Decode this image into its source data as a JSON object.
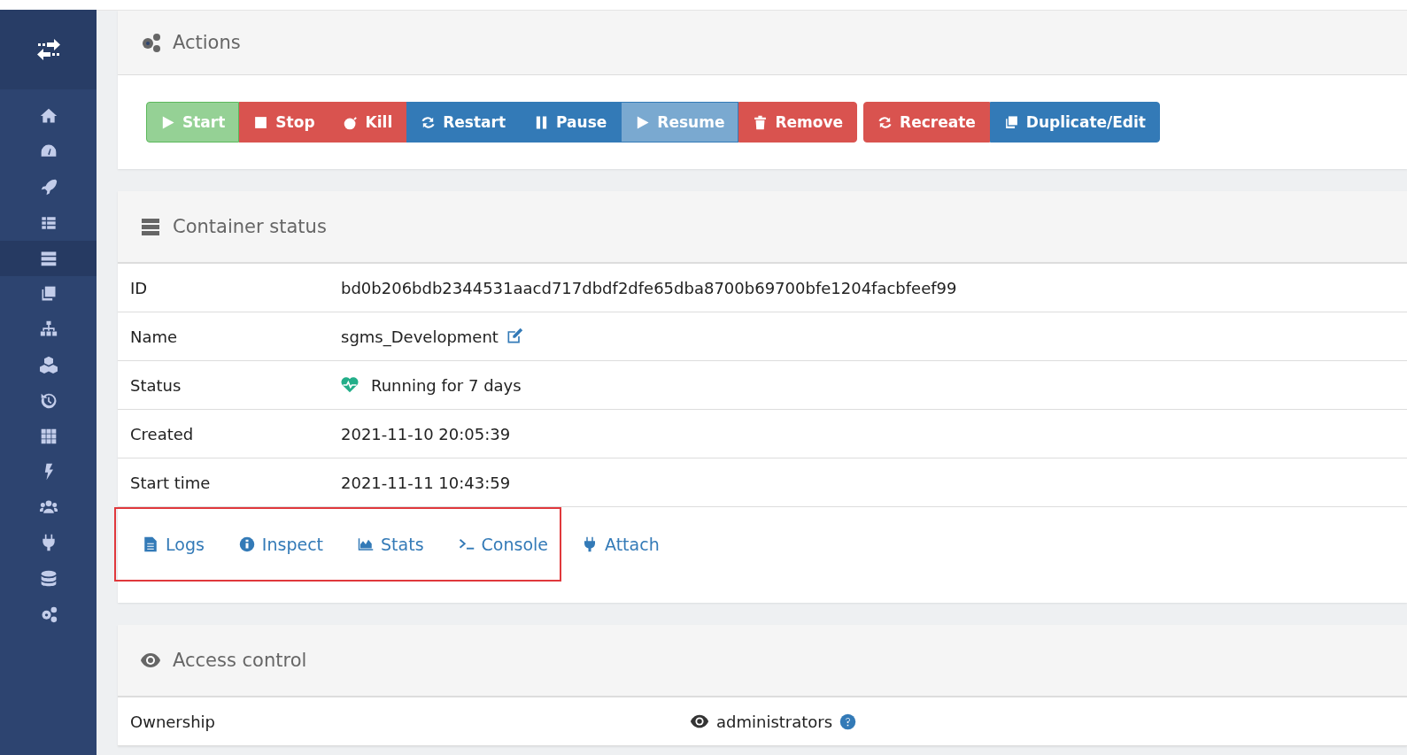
{
  "sidebar": {
    "items": [
      {
        "kind": "home",
        "selected": false
      },
      {
        "kind": "gauge",
        "selected": false
      },
      {
        "kind": "rocket",
        "selected": false
      },
      {
        "kind": "grid",
        "selected": false
      },
      {
        "kind": "server",
        "selected": true
      },
      {
        "kind": "copy",
        "selected": false
      },
      {
        "kind": "sitemap",
        "selected": false
      },
      {
        "kind": "cubes",
        "selected": false
      },
      {
        "kind": "history",
        "selected": false
      },
      {
        "kind": "apps",
        "selected": false
      },
      {
        "kind": "bolt",
        "selected": false
      },
      {
        "kind": "users",
        "selected": false
      },
      {
        "kind": "plug",
        "selected": false
      },
      {
        "kind": "database",
        "selected": false
      },
      {
        "kind": "cogs",
        "selected": false
      }
    ]
  },
  "actions": {
    "title": "Actions",
    "groups": [
      [
        {
          "label": "Start",
          "kind": "play",
          "color": "#5cb85c",
          "disabled": true
        },
        {
          "label": "Stop",
          "kind": "stop",
          "color": "#d9534f",
          "disabled": false
        },
        {
          "label": "Kill",
          "kind": "bomb",
          "color": "#d9534f",
          "disabled": false
        },
        {
          "label": "Restart",
          "kind": "refresh",
          "color": "#337ab7",
          "disabled": false
        },
        {
          "label": "Pause",
          "kind": "pause",
          "color": "#337ab7",
          "disabled": false
        },
        {
          "label": "Resume",
          "kind": "play",
          "color": "#337ab7",
          "disabled": true
        },
        {
          "label": "Remove",
          "kind": "trash",
          "color": "#d9534f",
          "disabled": false
        }
      ],
      [
        {
          "label": "Recreate",
          "kind": "refresh",
          "color": "#d9534f",
          "disabled": false
        },
        {
          "label": "Duplicate/Edit",
          "kind": "copy",
          "color": "#337ab7",
          "disabled": false
        }
      ]
    ]
  },
  "container_status": {
    "title": "Container status",
    "rows": [
      {
        "label": "ID",
        "value": "bd0b206bdb2344531aacd717dbdf2dfe65dba8700b69700bfe1204facbfeef99"
      },
      {
        "label": "Name",
        "value": "sgms_Development",
        "kind": "edit"
      },
      {
        "label": "Status",
        "value": "Running for 7 days",
        "kind": "heartbeat"
      },
      {
        "label": "Created",
        "value": "2021-11-10 20:05:39"
      },
      {
        "label": "Start time",
        "value": "2021-11-11 10:43:59"
      }
    ],
    "links": [
      {
        "label": "Logs",
        "kind": "file",
        "highlighted": true
      },
      {
        "label": "Inspect",
        "kind": "info",
        "highlighted": true
      },
      {
        "label": "Stats",
        "kind": "chart",
        "highlighted": true
      },
      {
        "label": "Console",
        "kind": "terminal",
        "highlighted": true
      },
      {
        "label": "Attach",
        "kind": "plug",
        "highlighted": false
      }
    ]
  },
  "access_control": {
    "title": "Access control",
    "rows": [
      {
        "label": "Ownership",
        "value": "administrators"
      }
    ]
  }
}
